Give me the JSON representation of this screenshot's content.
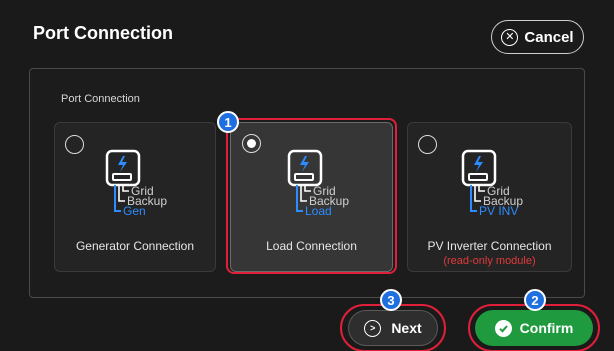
{
  "header": {
    "title": "Port Connection",
    "cancel_label": "Cancel"
  },
  "panel": {
    "label": "Port Connection"
  },
  "options": [
    {
      "name": "Generator Connection",
      "sub": "",
      "selected": false,
      "diagram": {
        "line1": "Grid",
        "line2": "Backup",
        "line3": "Gen"
      }
    },
    {
      "name": "Load Connection",
      "sub": "",
      "selected": true,
      "diagram": {
        "line1": "Grid",
        "line2": "Backup",
        "line3": "Load"
      }
    },
    {
      "name": "PV Inverter Connection",
      "sub": "(read-only module)",
      "selected": false,
      "diagram": {
        "line1": "Grid",
        "line2": "Backup",
        "line3": "PV INV"
      }
    }
  ],
  "badges": {
    "step1": "1",
    "step2": "2",
    "step3": "3"
  },
  "footer": {
    "next_label": "Next",
    "confirm_label": "Confirm"
  },
  "colors": {
    "accent_blue": "#2d8cff",
    "confirm_green": "#1f9a3e",
    "highlight_red": "#e0203a",
    "warning_red": "#e23a3a"
  }
}
